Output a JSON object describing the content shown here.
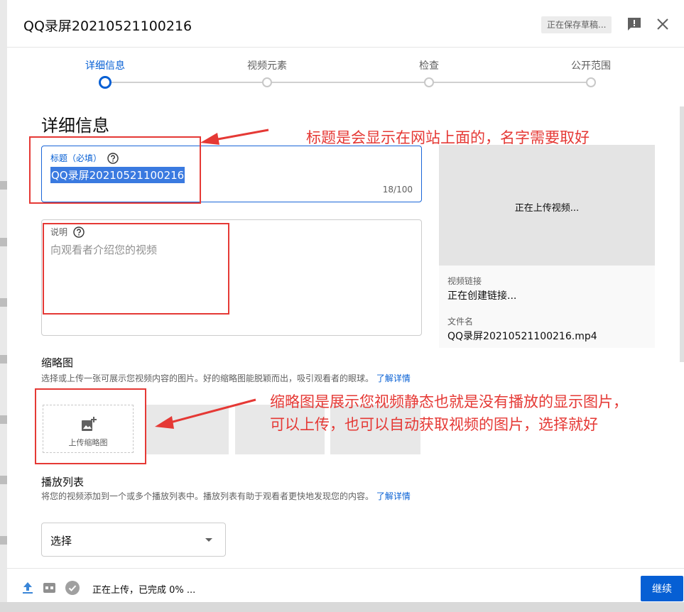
{
  "header": {
    "title": "QQ录屏20210521100216",
    "saving_badge": "正在保存草稿..."
  },
  "steps": [
    {
      "label": "详细信息",
      "active": true
    },
    {
      "label": "视频元素",
      "active": false
    },
    {
      "label": "检查",
      "active": false
    },
    {
      "label": "公开范围",
      "active": false
    }
  ],
  "details": {
    "section_title": "详细信息",
    "title_field": {
      "label": "标题（必填）",
      "value": "QQ录屏20210521100216",
      "counter": "18/100"
    },
    "description_field": {
      "label": "说明",
      "placeholder": "向观看者介绍您的视频"
    },
    "thumbnail": {
      "title": "缩略图",
      "description": "选择或上传一张可展示您视频内容的图片。好的缩略图能脱颖而出，吸引观看者的眼球。",
      "learn_more": "了解详情",
      "upload_label": "上传缩略图"
    },
    "playlist": {
      "title": "播放列表",
      "description": "将您的视频添加到一个或多个播放列表中。播放列表有助于观看者更快地发现您的内容。",
      "learn_more": "了解详情",
      "select_label": "选择"
    }
  },
  "preview": {
    "uploading_text": "正在上传视频...",
    "link_label": "视频链接",
    "link_value": "正在创建链接...",
    "filename_label": "文件名",
    "filename_value": "QQ录屏20210521100216.mp4"
  },
  "footer": {
    "status": "正在上传，已完成 0% ...",
    "continue_label": "继续"
  },
  "annotations": {
    "title_note": "标题是会显示在网站上面的，名字需要取好",
    "thumbnail_note_1": "缩略图是展示您视频静态也就是没有播放的显示图片，",
    "thumbnail_note_2": "可以上传，也可以自动获取视频的图片，选择就好"
  },
  "colors": {
    "accent": "#065fd4",
    "annotation": "#e53935"
  }
}
